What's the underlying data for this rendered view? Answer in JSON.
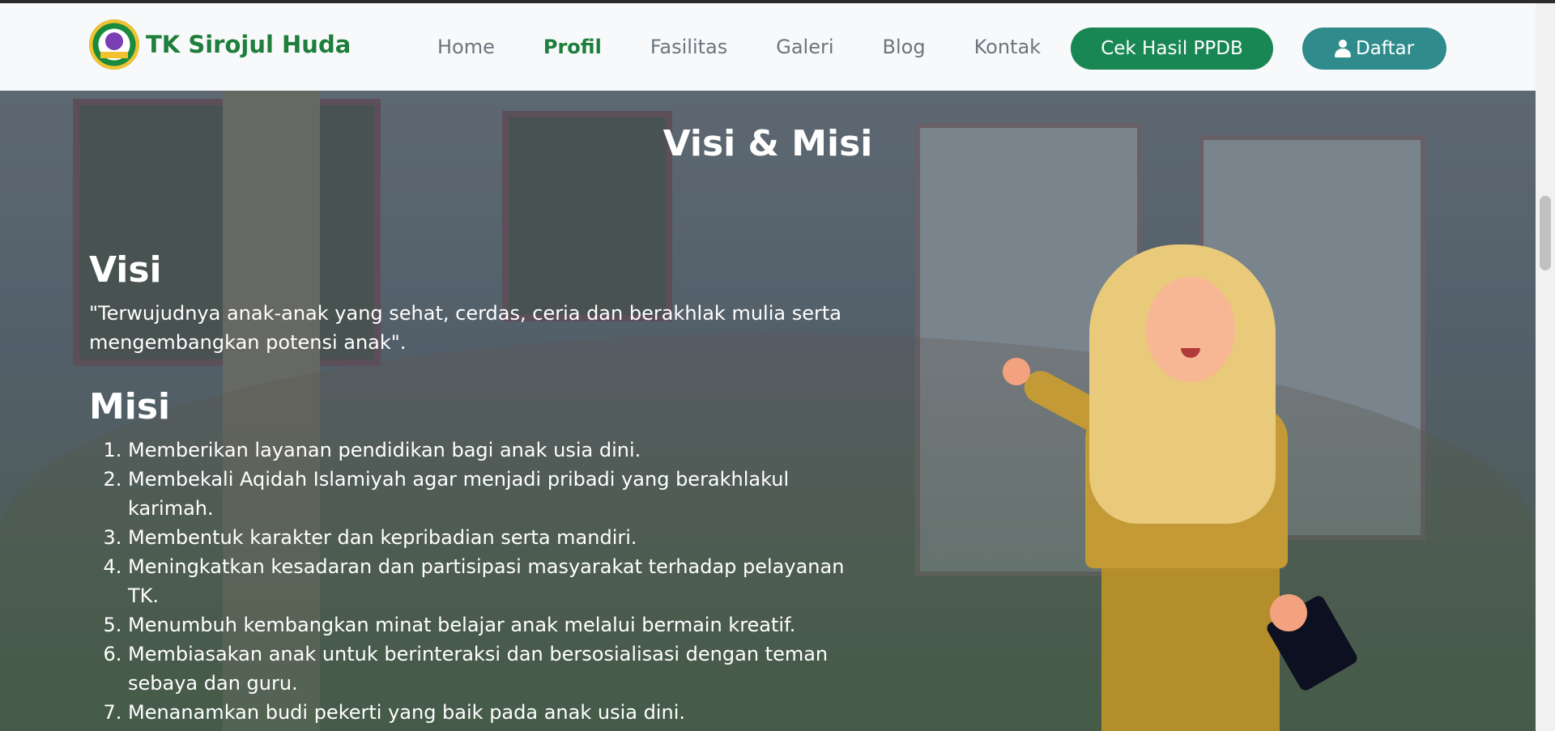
{
  "header": {
    "brand_name": "TK Sirojul Huda",
    "logo_icon": "school-logo-icon",
    "nav": [
      {
        "label": "Home",
        "active": false
      },
      {
        "label": "Profil",
        "active": true
      },
      {
        "label": "Fasilitas",
        "active": false
      },
      {
        "label": "Galeri",
        "active": false
      },
      {
        "label": "Blog",
        "active": false
      },
      {
        "label": "Kontak",
        "active": false
      }
    ],
    "cek_ppdb_label": "Cek Hasil PPDB",
    "daftar_label": "Daftar",
    "daftar_icon": "user-icon"
  },
  "hero": {
    "title": "Visi & Misi",
    "visi_heading": "Visi",
    "visi_text": "\"Terwujudnya anak-anak yang sehat, cerdas, ceria dan berakhlak mulia serta mengembangkan potensi anak\".",
    "misi_heading": "Misi",
    "misi_items": [
      "Memberikan layanan pendidikan bagi anak usia dini.",
      "Membekali Aqidah Islamiyah agar menjadi pribadi yang berakhlakul karimah.",
      "Membentuk karakter dan kepribadian serta mandiri.",
      "Meningkatkan kesadaran dan partisipasi masyarakat terhadap pelayanan TK.",
      "Menumbuh kembangkan minat belajar anak melalui bermain kreatif.",
      "Membiasakan anak untuk berinteraksi dan bersosialisasi dengan teman sebaya dan guru.",
      "Menanamkan budi pekerti yang baik pada anak usia dini."
    ]
  },
  "colors": {
    "brand_green": "#1e7e3c",
    "ppdb_button": "#198754",
    "daftar_button": "#2f8b8c",
    "nav_text": "#6c757d"
  }
}
